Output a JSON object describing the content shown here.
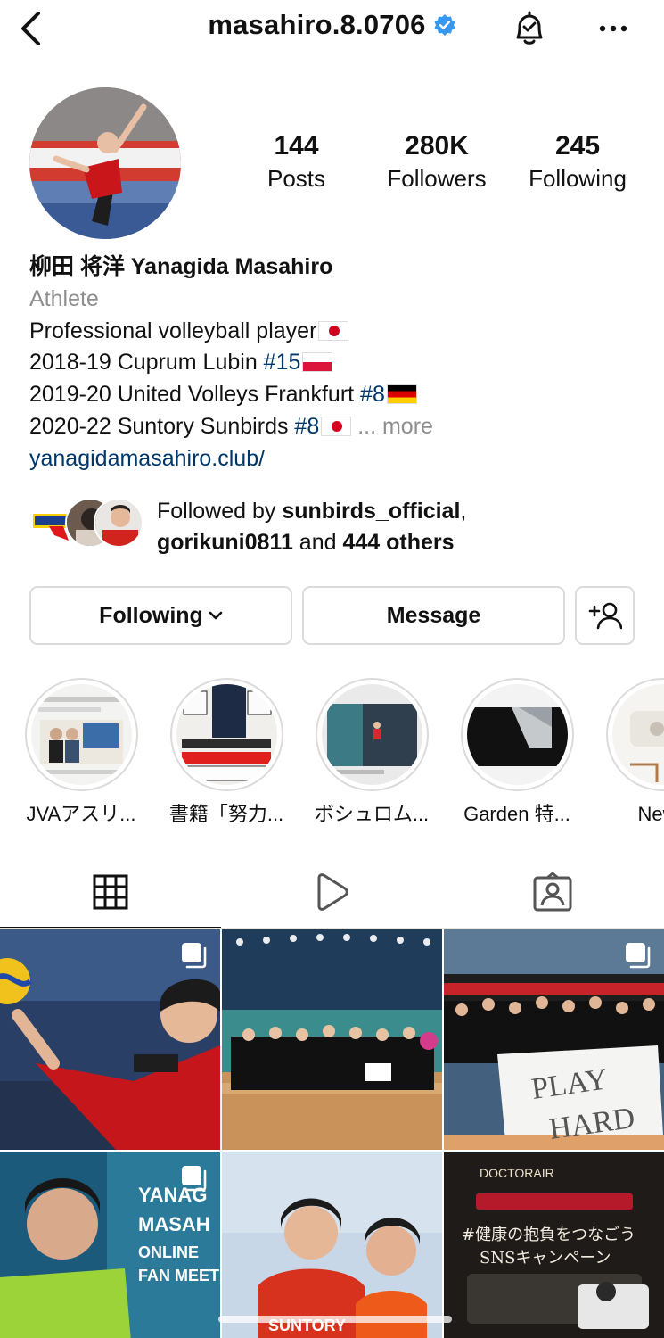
{
  "header": {
    "username": "masahiro.8.0706",
    "verified": true,
    "icons": [
      "back-chevron-icon",
      "verified-badge-icon",
      "bell-check-icon",
      "more-horizontal-icon"
    ]
  },
  "stats": {
    "posts_count": "144",
    "posts_label": "Posts",
    "followers_count": "280K",
    "followers_label": "Followers",
    "following_count": "245",
    "following_label": "Following"
  },
  "bio": {
    "display_name": "柳田 将洋 Yanagida Masahiro",
    "category": "Athlete",
    "line1": "Professional volleyball player",
    "line2_prefix": "2018-19 Cuprum Lubin ",
    "line2_tag": "#15",
    "line3_prefix": "2019-20 United Volleys Frankfurt ",
    "line3_tag": "#8",
    "line4_prefix": "2020-22 Suntory Sunbirds ",
    "line4_tag": "#8",
    "ellipsis": "...",
    "more": "more",
    "link": "yanagidamasahiro.club/"
  },
  "followed_by": {
    "prefix": "Followed by ",
    "user1": "sunbirds_official",
    "comma": ",",
    "user2": "gorikuni0811",
    "and_text": " and ",
    "others": "444 others"
  },
  "buttons": {
    "following": "Following",
    "message": "Message"
  },
  "highlights": [
    {
      "label": "JVAアスリ..."
    },
    {
      "label": "書籍「努力..."
    },
    {
      "label": "ボシュロム..."
    },
    {
      "label": "Garden 特..."
    },
    {
      "label": "New i"
    }
  ],
  "tabs": {
    "active": "grid",
    "items": [
      "grid-icon",
      "reels-play-icon",
      "tagged-person-icon"
    ]
  },
  "colors": {
    "link": "#00376b",
    "secondary_text": "#8e8e8e",
    "border": "#dbdbdb",
    "verified": "#3897f0"
  },
  "posts": [
    {
      "overlay_text": ""
    },
    {
      "overlay_text": ""
    },
    {
      "overlay_text": "PLAY HARD"
    },
    {
      "overlay_text": "YANAG MASAH ONLINE FAN MEET"
    },
    {
      "overlay_text": "SUNTORY"
    },
    {
      "overlay_text": "#健康の抱負をつなごう SNSキャンペーン"
    }
  ]
}
